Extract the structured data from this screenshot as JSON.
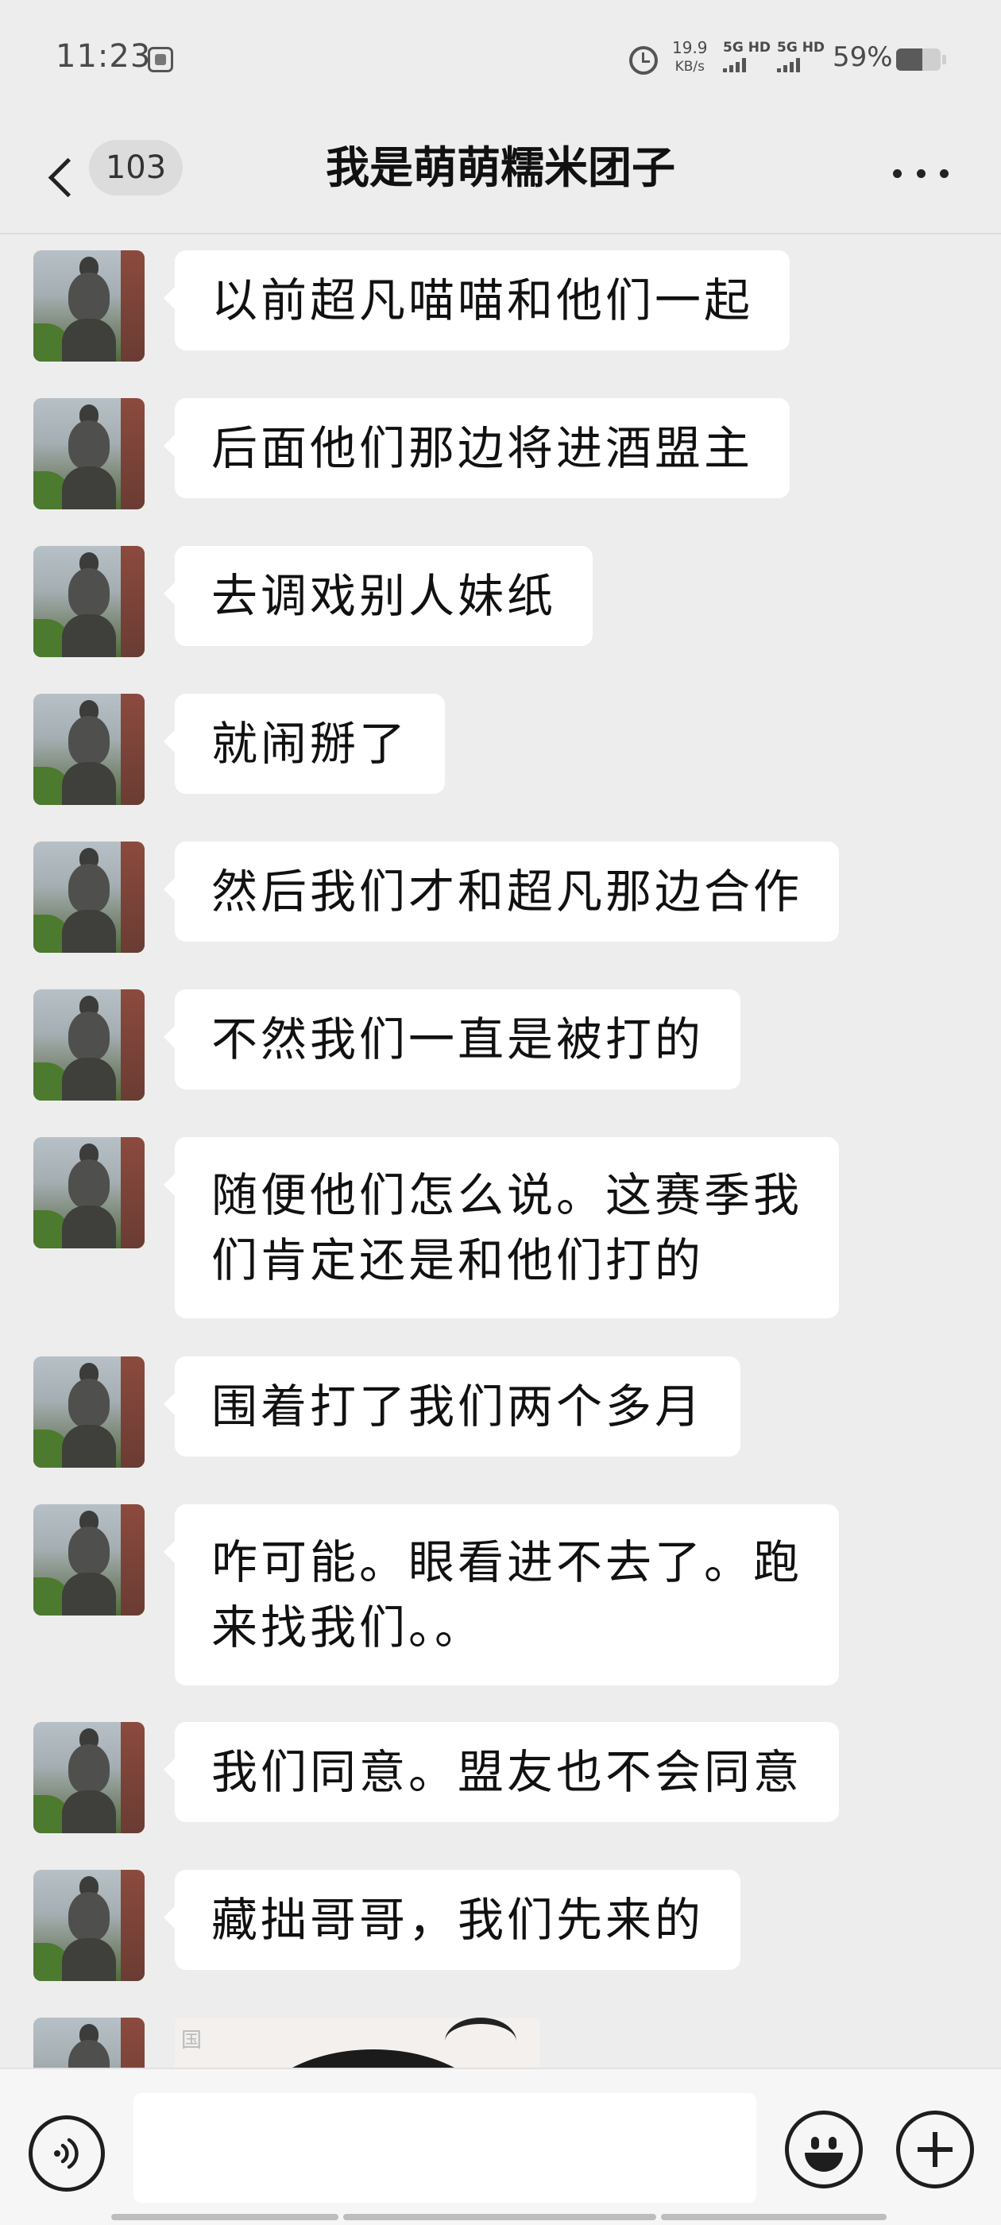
{
  "status_bar": {
    "time": "11:23",
    "net_speed_value": "19.9",
    "net_speed_unit": "KB/s",
    "signal_1_label": "5G HD",
    "signal_2_label": "5G HD",
    "battery_percent": "59%",
    "battery_level": 0.59,
    "icons": [
      "sim-icon",
      "alarm-icon",
      "signal-icon",
      "battery-icon"
    ]
  },
  "header": {
    "unread_count": "103",
    "title": "我是萌萌糯米团子",
    "icons": [
      "back-chevron-icon",
      "more-options-icon"
    ]
  },
  "messages": [
    {
      "sender": "other",
      "type": "text",
      "text": "以前超凡喵喵和他们一起"
    },
    {
      "sender": "other",
      "type": "text",
      "text": "后面他们那边将进酒盟主"
    },
    {
      "sender": "other",
      "type": "text",
      "text": "去调戏别人妹纸"
    },
    {
      "sender": "other",
      "type": "text",
      "text": "就闹掰了"
    },
    {
      "sender": "other",
      "type": "text",
      "text": "然后我们才和超凡那边合作"
    },
    {
      "sender": "other",
      "type": "text",
      "text": "不然我们一直是被打的"
    },
    {
      "sender": "other",
      "type": "text",
      "text": "随便他们怎么说。这赛季我\n们肯定还是和他们打的"
    },
    {
      "sender": "other",
      "type": "text",
      "text": "围着打了我们两个多月"
    },
    {
      "sender": "other",
      "type": "text",
      "text": "咋可能。眼看进不去了。跑\n来找我们。。"
    },
    {
      "sender": "other",
      "type": "text",
      "text": "我们同意。盟友也不会同意"
    },
    {
      "sender": "other",
      "type": "text",
      "text": "藏拙哥哥，我们先来的"
    },
    {
      "sender": "other",
      "type": "image",
      "watermark": "国"
    }
  ],
  "input_bar": {
    "text_value": "",
    "icons": [
      "voice-icon",
      "emoji-icon",
      "plus-icon"
    ]
  },
  "colors": {
    "background": "#ededed",
    "bubble": "#ffffff",
    "input_bar": "#f6f6f6"
  }
}
